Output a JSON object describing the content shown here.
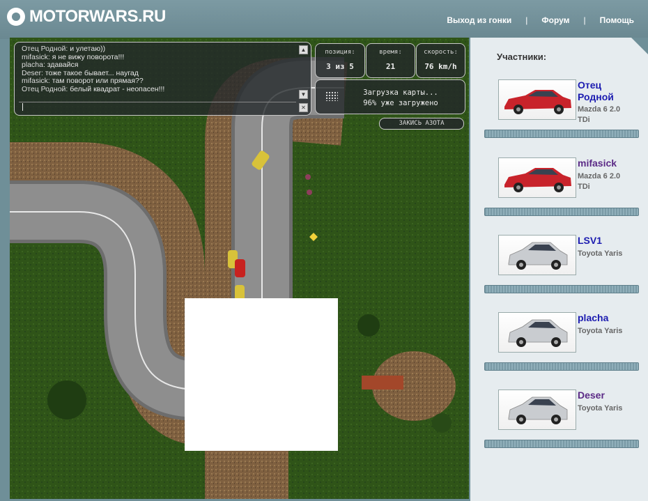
{
  "brand": "MOTORWARS.RU",
  "nav": {
    "exit": "Выход из гонки",
    "sep1": "|",
    "forum": "Форум",
    "sep2": "|",
    "help": "Помощь"
  },
  "chat": {
    "lines": [
      {
        "nick": "Отец Родной:",
        "text": "и улетаю))"
      },
      {
        "nick": "mifasick:",
        "text": "я не вижу поворота!!!"
      },
      {
        "nick": "placha:",
        "text": "здавайся"
      },
      {
        "nick": "Deser:",
        "text": "тоже такое бывает... наугад"
      },
      {
        "nick": "mifasick:",
        "text": "там поворот или прямая??"
      },
      {
        "nick": "Отец Родной:",
        "text": "белый квадрат - неопасен!!!"
      }
    ],
    "input_value": ""
  },
  "hud": {
    "position_label": "позиция:",
    "position_value": "3 из 5",
    "time_label": "время:",
    "time_value": "21",
    "speed_label": "скорость:",
    "speed_value": "76 km/h",
    "loading_line1": "Загрузка карты...",
    "loading_line2": "96% уже загружено",
    "loading_progress": 0.96,
    "nitro_button": "ЗАКИСЬ АЗОТА"
  },
  "sidebar": {
    "title": "Участники:",
    "participants": [
      {
        "name": "Отец Родной",
        "car": "Mazda 6 2.0 TDi",
        "name_color": "#1b1bb0",
        "car_color": "#c8232b"
      },
      {
        "name": "mifasick",
        "car": "Mazda 6 2.0 TDi",
        "name_color": "#5b2a86",
        "car_color": "#c8232b"
      },
      {
        "name": "LSV1",
        "car": "Toyota Yaris",
        "name_color": "#1b1bb0",
        "car_color": "#c9ccd0"
      },
      {
        "name": "placha",
        "car": "Toyota Yaris",
        "name_color": "#1b1bb0",
        "car_color": "#c9ccd0"
      },
      {
        "name": "Deser",
        "car": "Toyota Yaris",
        "name_color": "#5b2a86",
        "car_color": "#c9ccd0"
      }
    ]
  },
  "colors": {
    "header_bg": "#6f8f98",
    "grass": "#2f5418",
    "road": "#8c8c8c",
    "dirt": "#8a6a42",
    "sidebar_bg": "#e6ecef"
  }
}
